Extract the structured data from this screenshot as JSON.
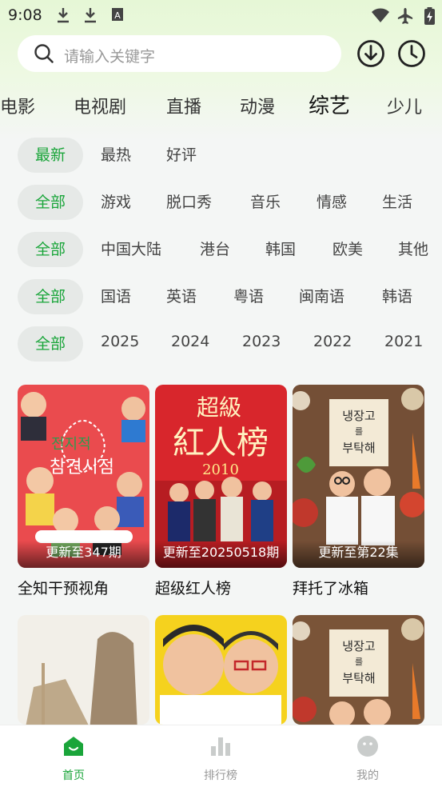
{
  "status_bar": {
    "time": "9:08"
  },
  "search": {
    "placeholder": "请输入关键字"
  },
  "categories": [
    "电影",
    "电视剧",
    "直播",
    "动漫",
    "综艺",
    "少儿"
  ],
  "active_category": "综艺",
  "filters": {
    "sort": [
      "最新",
      "最热",
      "好评"
    ],
    "genre": [
      "全部",
      "游戏",
      "脱口秀",
      "音乐",
      "情感",
      "生活"
    ],
    "region": [
      "全部",
      "中国大陆",
      "港台",
      "韩国",
      "欧美",
      "其他"
    ],
    "language": [
      "全部",
      "国语",
      "英语",
      "粤语",
      "闽南语",
      "韩语"
    ],
    "year": [
      "全部",
      "2025",
      "2024",
      "2023",
      "2022",
      "2021"
    ]
  },
  "cards": [
    {
      "title": "全知干预视角",
      "update": "更新至347期",
      "poster_text": [
        "전지적",
        "참견시점"
      ]
    },
    {
      "title": "超级红人榜",
      "update": "更新至20250518期",
      "poster_text": [
        "超級",
        "紅人榜",
        "2010"
      ]
    },
    {
      "title": "拜托了冰箱",
      "update": "更新至第22集",
      "poster_text": [
        "냉장고",
        "를",
        "부탁해"
      ]
    },
    {
      "title": "",
      "update": "",
      "poster_text": []
    },
    {
      "title": "",
      "update": "",
      "poster_text": []
    },
    {
      "title": "",
      "update": "",
      "poster_text": [
        "냉장고",
        "를",
        "부탁해"
      ]
    }
  ],
  "bottom_nav": [
    {
      "label": "首页",
      "icon": "home-icon",
      "active": true
    },
    {
      "label": "排行榜",
      "icon": "ranking-icon",
      "active": false
    },
    {
      "label": "我的",
      "icon": "profile-icon",
      "active": false
    }
  ],
  "colors": {
    "accent": "#1aa53a"
  }
}
